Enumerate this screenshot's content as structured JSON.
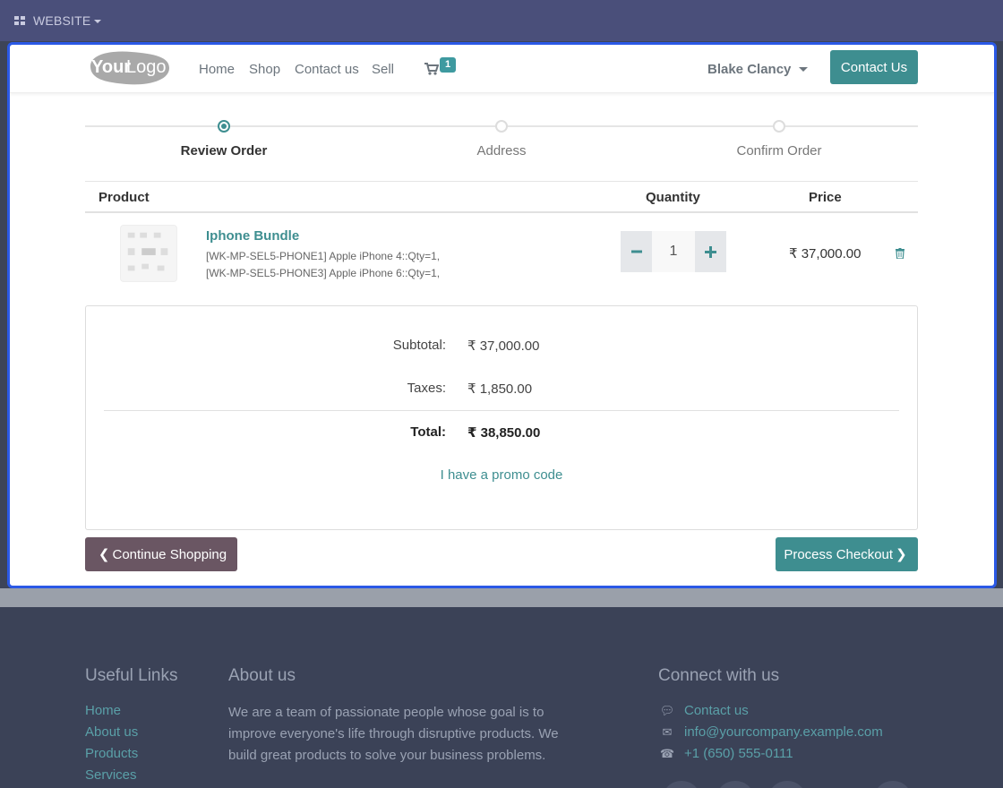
{
  "admin_bar": {
    "website_label": "WEBSITE"
  },
  "logo": {
    "text_part1": "Your",
    "text_part2": "Logo"
  },
  "navbar": {
    "links": [
      "Home",
      "Shop",
      "Contact us",
      "Sell"
    ],
    "cart_count": "1",
    "user_name": "Blake Clancy",
    "contact_button": "Contact Us"
  },
  "steps": [
    {
      "label": "Review Order",
      "active": true
    },
    {
      "label": "Address",
      "active": false
    },
    {
      "label": "Confirm Order",
      "active": false
    }
  ],
  "table": {
    "headers": {
      "product": "Product",
      "quantity": "Quantity",
      "price": "Price"
    },
    "rows": [
      {
        "name": "Iphone Bundle",
        "line1": "[WK-MP-SEL5-PHONE1] Apple iPhone 4::Qty=1,",
        "line2": "[WK-MP-SEL5-PHONE3] Apple iPhone 6::Qty=1,",
        "quantity": "1",
        "price": "₹ 37,000.00"
      }
    ]
  },
  "summary": {
    "subtotal_label": "Subtotal:",
    "subtotal_value": "₹ 37,000.00",
    "taxes_label": "Taxes:",
    "taxes_value": "₹ 1,850.00",
    "total_label": "Total:",
    "total_value": "₹ 38,850.00",
    "promo_link": "I have a promo code"
  },
  "actions": {
    "continue_label": "Continue Shopping",
    "checkout_label": "Process Checkout"
  },
  "footer": {
    "useful_links_title": "Useful Links",
    "useful_links": [
      "Home",
      "About us",
      "Products",
      "Services"
    ],
    "about_title": "About us",
    "about_text": "We are a team of passionate people whose goal is to improve everyone's life through disruptive products. We build great products to solve your business problems.",
    "connect_title": "Connect with us",
    "contact_items": [
      "Contact us",
      "info@yourcompany.example.com",
      "+1 (650) 555-0111"
    ]
  },
  "colors": {
    "accent": "#3e8e90",
    "admin_bar": "#4a4f7a",
    "frame_border": "#2b59e6",
    "secondary_button": "#6a5663",
    "footer_bg": "#3b4257"
  }
}
